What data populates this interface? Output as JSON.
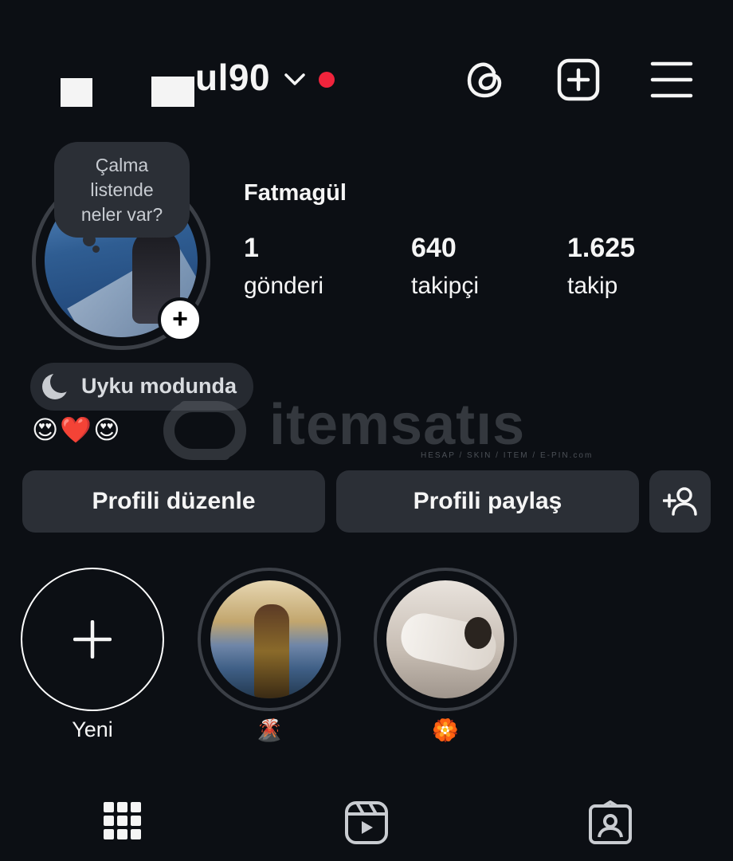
{
  "header": {
    "username_visible": "ul90",
    "icons": [
      "threads-icon",
      "create-post-icon",
      "menu-icon"
    ],
    "notification_dot_color": "#f0243c"
  },
  "profile": {
    "note": [
      "Çalma",
      "listende",
      "neler var?"
    ],
    "display_name": "Fatmagül",
    "stats": [
      {
        "value": "1",
        "label": "gönderi"
      },
      {
        "value": "640",
        "label": "takipçi"
      },
      {
        "value": "1.625",
        "label": "takip"
      }
    ],
    "status": "Uyku modunda",
    "bio": "😍❤️😍"
  },
  "watermark": {
    "text": "itemsatıs",
    "sub": "HESAP / SKIN / ITEM / E-PIN.com"
  },
  "buttons": {
    "edit": "Profili düzenle",
    "share": "Profili paylaş"
  },
  "highlights": [
    {
      "label": "Yeni"
    },
    {
      "label": "🌋"
    },
    {
      "label": "🏵️"
    }
  ],
  "bottom_nav": [
    "grid-icon",
    "reels-icon",
    "tagged-icon"
  ],
  "colors": {
    "background": "#0c0f14",
    "button": "#2b2f36",
    "accent_red": "#f0243c"
  }
}
